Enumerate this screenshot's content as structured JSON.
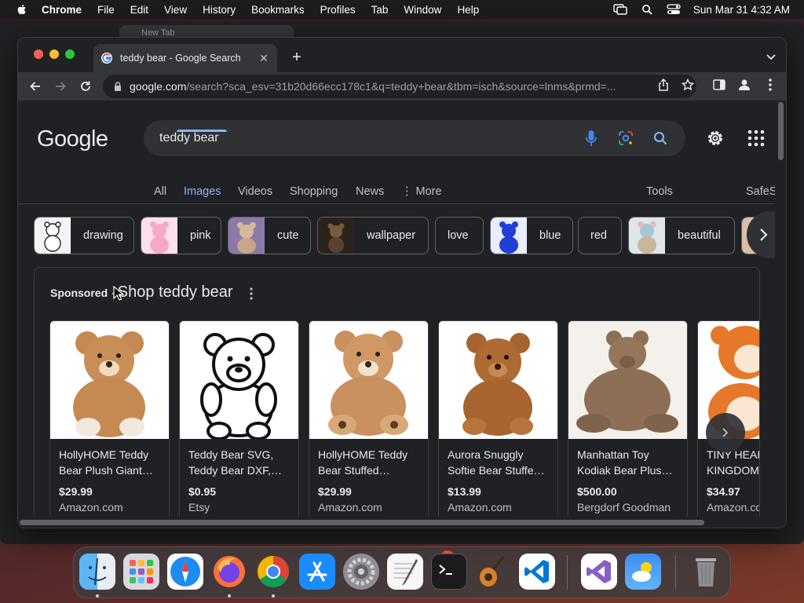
{
  "menubar": {
    "app_name": "Chrome",
    "items": [
      "File",
      "Edit",
      "View",
      "History",
      "Bookmarks",
      "Profiles",
      "Tab",
      "Window",
      "Help"
    ],
    "clock": "Sun Mar 31  4:32 AM"
  },
  "background_window": {
    "tab_title": "New Tab"
  },
  "browser": {
    "tab_title": "teddy bear - Google Search",
    "url_host": "google.com",
    "url_path": "/search?sca_esv=31b20d66ecc178c1&q=teddy+bear&tbm=isch&source=lnms&prmd=..."
  },
  "google": {
    "logo": "Google",
    "query": "teddy bear",
    "tabs": [
      "All",
      "Images",
      "Videos",
      "Shopping",
      "News",
      "More",
      "Tools",
      "SafeS"
    ],
    "active_tab": "Images",
    "chips": [
      {
        "label": "drawing",
        "thumb_color": "#f4f4f4"
      },
      {
        "label": "pink",
        "thumb_color": "#f5a9c8"
      },
      {
        "label": "cute",
        "thumb_color": "#c9a58a"
      },
      {
        "label": "wallpaper",
        "thumb_color": "#4a3a2c"
      },
      {
        "label": "love",
        "thumb_color": null
      },
      {
        "label": "blue",
        "thumb_color": "#1f3fd6"
      },
      {
        "label": "red",
        "thumb_color": null
      },
      {
        "label": "beautiful",
        "thumb_color": "#a9c6d6"
      }
    ],
    "shopping": {
      "sponsored": "Sponsored",
      "title": "Shop teddy bear",
      "products": [
        {
          "name": "HollyHOME Teddy Bear Plush Giant…",
          "price": "$29.99",
          "seller": "Amazon.com",
          "color": "#c58a52"
        },
        {
          "name": "Teddy Bear SVG, Teddy Bear DXF,…",
          "price": "$0.95",
          "seller": "Etsy",
          "color": "#ffffff"
        },
        {
          "name": "HollyHOME Teddy Bear Stuffed…",
          "price": "$29.99",
          "seller": "Amazon.com",
          "color": "#c99060"
        },
        {
          "name": "Aurora Snuggly Softie Bear Stuffe…",
          "price": "$13.99",
          "seller": "Amazon.com",
          "color": "#a8642e"
        },
        {
          "name": "Manhattan Toy Kodiak Bear Plus…",
          "price": "$500.00",
          "seller": "Bergdorf Goodman",
          "color": "#8e6f55"
        },
        {
          "name": "TINY HEAR KINGDOM",
          "price": "$34.97",
          "seller": "Amazon.co",
          "color": "#e6782a"
        }
      ]
    }
  },
  "dock": {
    "apps": [
      "Finder",
      "Launchpad",
      "Safari",
      "Firefox",
      "Chrome",
      "App Store",
      "System Settings",
      "TextEdit",
      "Terminal",
      "GarageBand",
      "Visual Studio Code",
      "Visual Studio",
      "Weather",
      "Trash"
    ],
    "settings_badge": "1"
  },
  "colors": {
    "accent": "#8ab4f8",
    "page_bg": "#202124",
    "chrome_toolbar": "#35363a"
  }
}
